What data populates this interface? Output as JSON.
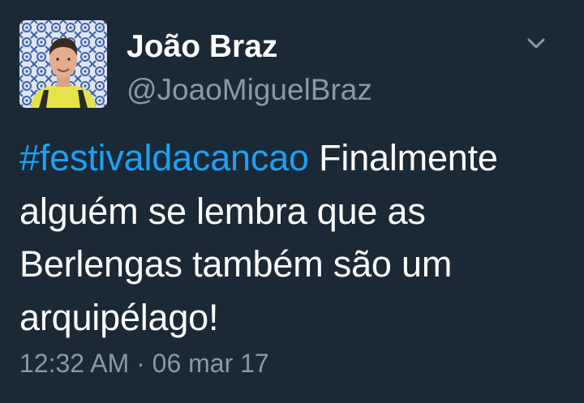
{
  "tweet": {
    "author": {
      "display_name": "João Braz",
      "handle": "@JoaoMiguelBraz"
    },
    "text": {
      "hashtag": "#festivaldacancao",
      "body": " Finalmente alguém se lembra que as Berlengas também são um arquipélago!"
    },
    "timestamp": {
      "time": "12:32 AM",
      "separator": " · ",
      "date": "06 mar 17"
    },
    "menu_icon": "chevron-down-icon"
  },
  "colors": {
    "background": "#1b2836",
    "text": "#ffffff",
    "secondary_text": "#8899a6",
    "link": "#1da1f2"
  }
}
